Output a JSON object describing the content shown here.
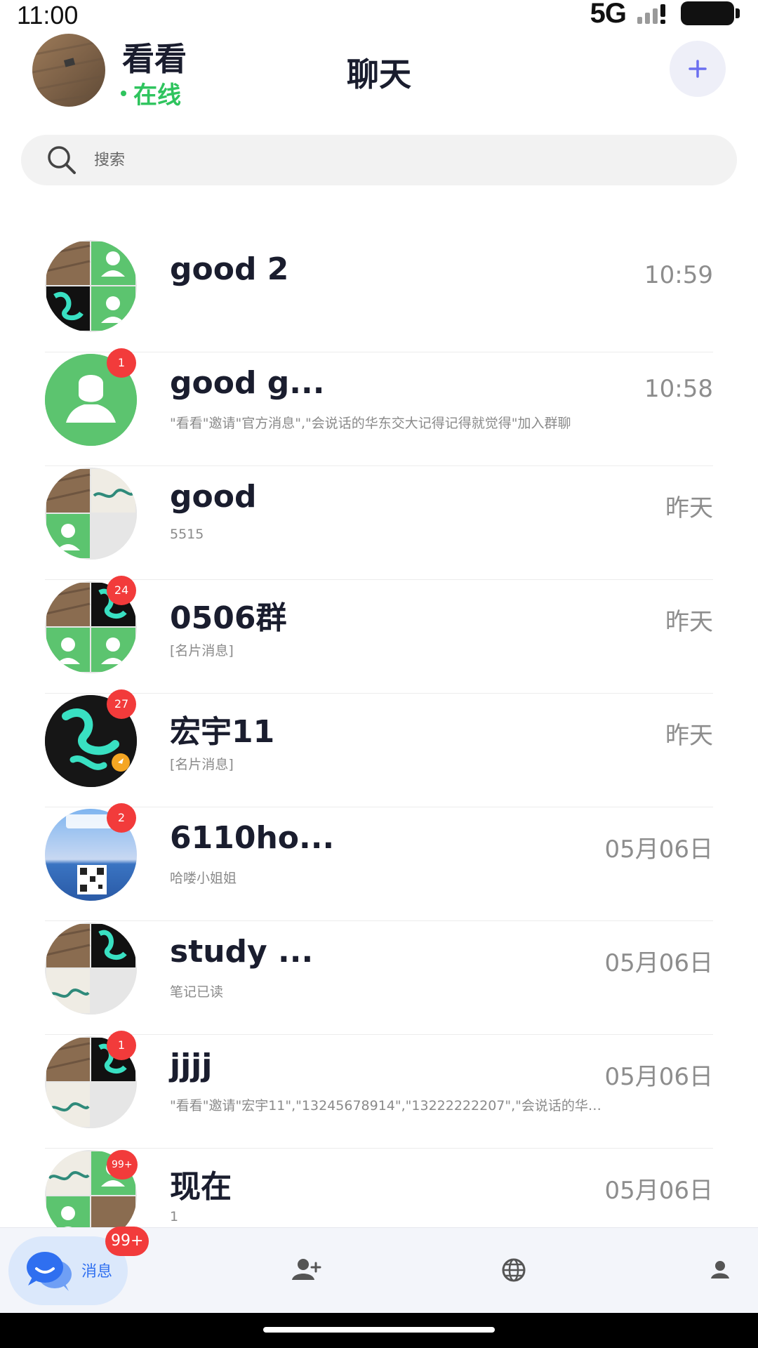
{
  "status_bar": {
    "time": "11:00",
    "network": "5G"
  },
  "header": {
    "username": "看看",
    "status": "在线",
    "title": "聊天",
    "add_label": "+"
  },
  "search": {
    "placeholder": "搜索"
  },
  "chats": [
    {
      "name": "good 2",
      "preview": "",
      "time": "10:59",
      "badge": ""
    },
    {
      "name": "good g...",
      "preview": "\"看看\"邀请\"官方消息\",\"会说话的华东交大记得记得就觉得\"加入群聊",
      "time": "10:58",
      "badge": "1"
    },
    {
      "name": "good",
      "preview": "5515",
      "time": "昨天",
      "badge": ""
    },
    {
      "name": "0506群",
      "preview": "[名片消息]",
      "time": "昨天",
      "badge": "24"
    },
    {
      "name": "宏宇11",
      "preview": "[名片消息]",
      "time": "昨天",
      "badge": "27"
    },
    {
      "name": "6110ho...",
      "preview": "哈喽小姐姐",
      "time": "05月06日",
      "badge": "2"
    },
    {
      "name": "study ...",
      "preview": "笔记已读",
      "time": "05月06日",
      "badge": ""
    },
    {
      "name": "jjjj",
      "preview": "\"看看\"邀请\"宏宇11\",\"13245678914\",\"13222222207\",\"会说话的华…",
      "time": "05月06日",
      "badge": "1"
    },
    {
      "name": "现在",
      "preview": "1",
      "time": "05月06日",
      "badge": "99+"
    }
  ],
  "bottom_nav": {
    "messages_label": "消息",
    "messages_badge": "99+"
  },
  "colors": {
    "online_green": "#2fc45e",
    "badge_red": "#f23b3b",
    "accent_blue": "#2f6ff0",
    "contact_green": "#5cc46f"
  }
}
